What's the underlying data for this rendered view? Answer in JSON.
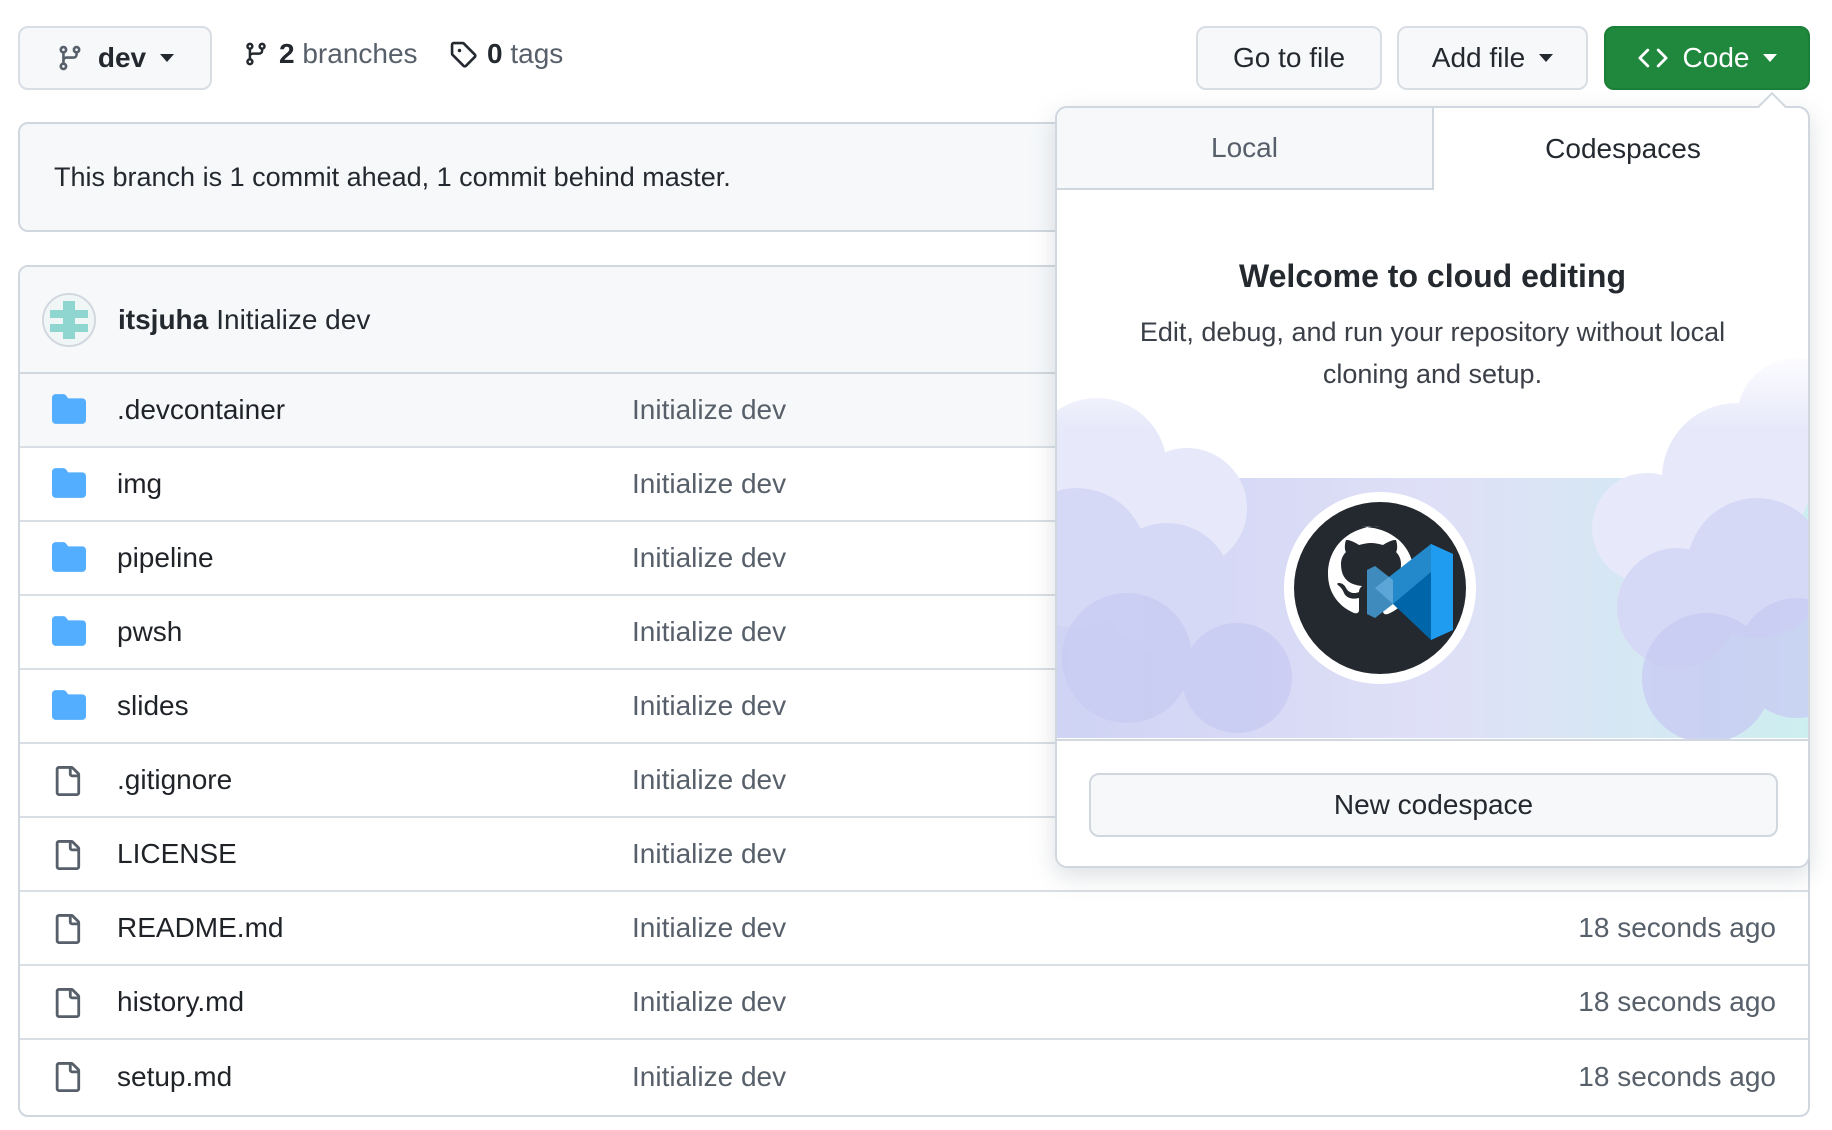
{
  "toolbar": {
    "branch": "dev",
    "branches_count": "2",
    "branches_label": "branches",
    "tags_count": "0",
    "tags_label": "tags",
    "goto_file": "Go to file",
    "add_file": "Add file",
    "code": "Code"
  },
  "branch_status": "This branch is 1 commit ahead, 1 commit behind master.",
  "latest_commit": {
    "author": "itsjuha",
    "message": "Initialize dev"
  },
  "files": [
    {
      "type": "dir",
      "name": ".devcontainer",
      "message": "Initialize dev",
      "time": ""
    },
    {
      "type": "dir",
      "name": "img",
      "message": "Initialize dev",
      "time": ""
    },
    {
      "type": "dir",
      "name": "pipeline",
      "message": "Initialize dev",
      "time": ""
    },
    {
      "type": "dir",
      "name": "pwsh",
      "message": "Initialize dev",
      "time": ""
    },
    {
      "type": "dir",
      "name": "slides",
      "message": "Initialize dev",
      "time": ""
    },
    {
      "type": "file",
      "name": ".gitignore",
      "message": "Initialize dev",
      "time": ""
    },
    {
      "type": "file",
      "name": "LICENSE",
      "message": "Initialize dev",
      "time": ""
    },
    {
      "type": "file",
      "name": "README.md",
      "message": "Initialize dev",
      "time": "18 seconds ago"
    },
    {
      "type": "file",
      "name": "history.md",
      "message": "Initialize dev",
      "time": "18 seconds ago"
    },
    {
      "type": "file",
      "name": "setup.md",
      "message": "Initialize dev",
      "time": "18 seconds ago"
    }
  ],
  "dropdown": {
    "tab_local": "Local",
    "tab_codespaces": "Codespaces",
    "active_tab": "Codespaces",
    "title": "Welcome to cloud editing",
    "description": "Edit, debug, and run your repository without local cloning and setup.",
    "new_codespace": "New codespace"
  },
  "colors": {
    "primary_green": "#1f883d",
    "folder_blue": "#54aeff",
    "muted_text": "#57606a",
    "border": "#d0d7de"
  },
  "icons": {
    "branch": "git-branch-icon",
    "tag": "tag-icon",
    "code": "code-brackets-icon",
    "folder": "folder-icon",
    "file": "file-icon"
  }
}
